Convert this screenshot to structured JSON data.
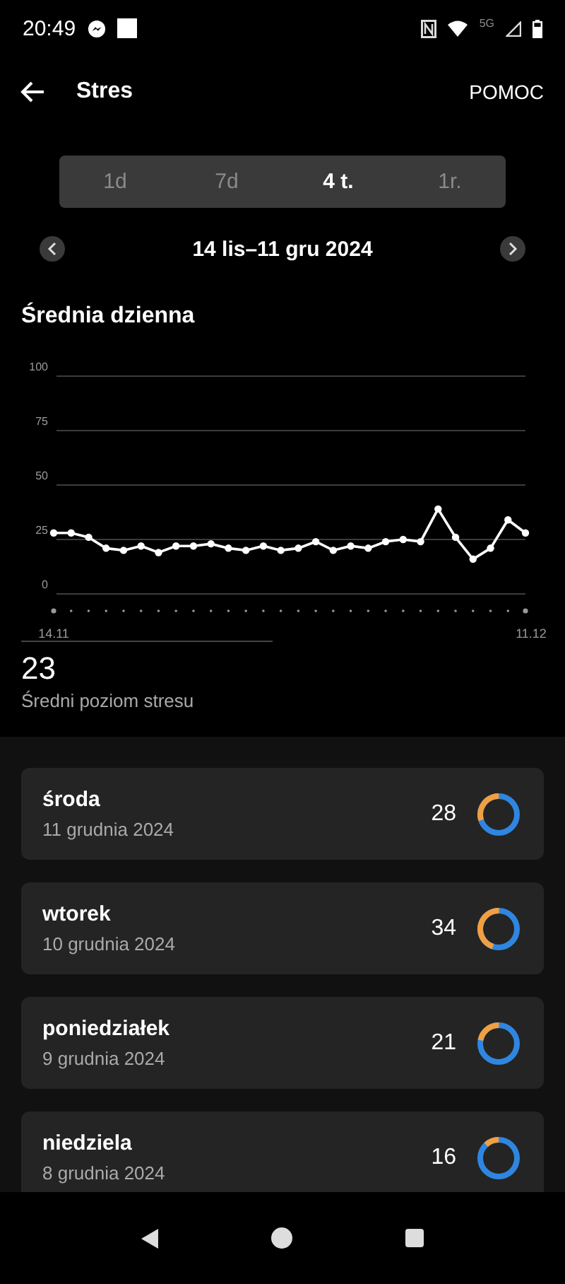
{
  "status_bar": {
    "time": "20:49",
    "network": "5G"
  },
  "header": {
    "title": "Stres",
    "action": "POMOC"
  },
  "tabs": [
    {
      "label": "1d",
      "selected": false
    },
    {
      "label": "7d",
      "selected": false
    },
    {
      "label": "4 t.",
      "selected": true
    },
    {
      "label": "1r.",
      "selected": false
    }
  ],
  "date_range": "14 lis–11 gru 2024",
  "section_title": "Średnia dzienna",
  "chart_data": {
    "type": "line",
    "grid": true,
    "ylim": [
      0,
      100
    ],
    "yticks": [
      0,
      25,
      50,
      75,
      100
    ],
    "categories": [
      "14.11",
      null,
      null,
      null,
      null,
      null,
      null,
      null,
      null,
      null,
      null,
      null,
      null,
      null,
      null,
      null,
      null,
      null,
      null,
      null,
      null,
      null,
      null,
      null,
      null,
      null,
      null,
      "11.12"
    ],
    "series": [
      {
        "color": "#ffffff",
        "marker": "circle",
        "values": [
          28,
          28,
          26,
          21,
          20,
          22,
          19,
          22,
          22,
          23,
          21,
          20,
          22,
          20,
          21,
          24,
          20,
          22,
          21,
          24,
          25,
          24,
          39,
          26,
          16,
          21,
          34,
          28
        ]
      }
    ]
  },
  "average": {
    "value": "23",
    "label": "Średni poziom stresu"
  },
  "days": [
    {
      "day": "środa",
      "date": "11 grudnia 2024",
      "value": "28",
      "level": 0.3
    },
    {
      "day": "wtorek",
      "date": "10 grudnia 2024",
      "value": "34",
      "level": 0.45
    },
    {
      "day": "poniedziałek",
      "date": "9 grudnia 2024",
      "value": "21",
      "level": 0.22
    },
    {
      "day": "niedziela",
      "date": "8 grudnia 2024",
      "value": "16",
      "level": 0.12
    }
  ]
}
